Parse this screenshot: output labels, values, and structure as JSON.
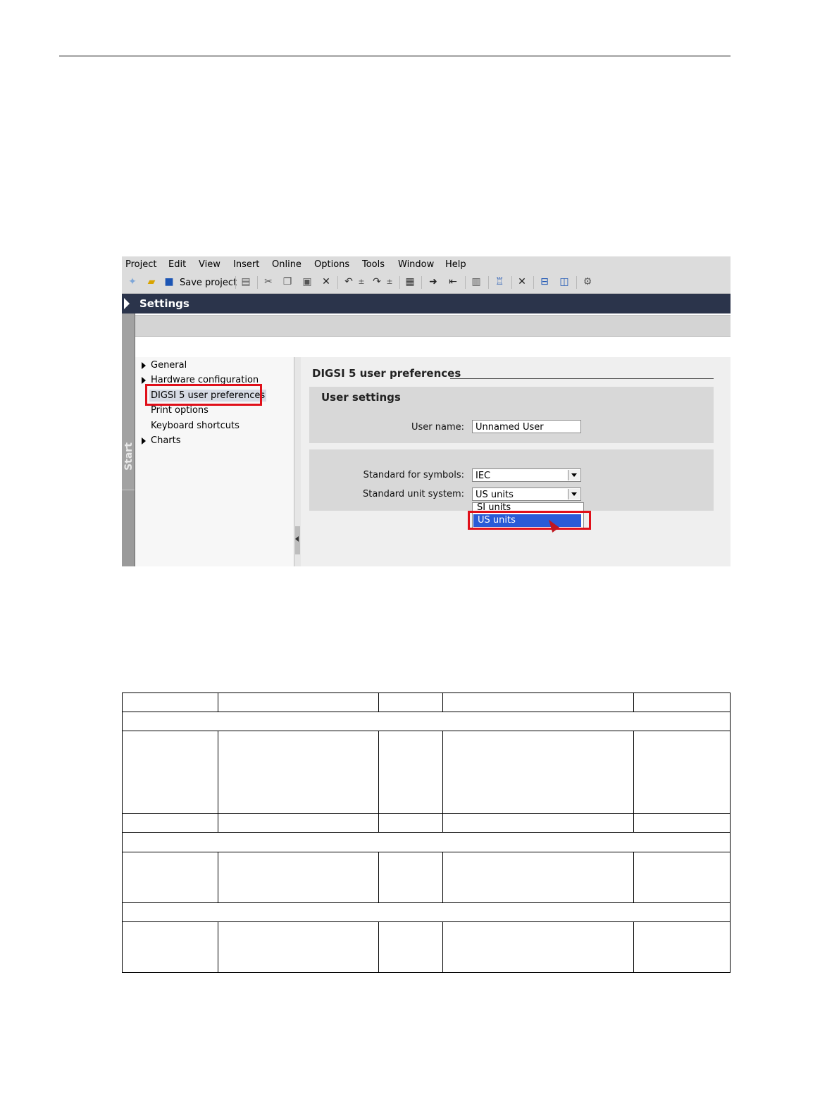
{
  "menu": [
    "Project",
    "Edit",
    "View",
    "Insert",
    "Online",
    "Options",
    "Tools",
    "Window",
    "Help"
  ],
  "toolbar": {
    "save_label": "Save project"
  },
  "window": {
    "title": "Settings",
    "start_tab": "Start"
  },
  "tree": [
    {
      "label": "General",
      "expandable": true
    },
    {
      "label": "Hardware configuration",
      "expandable": true
    },
    {
      "label": "DIGSI 5 user preferences",
      "expandable": false,
      "selected": true
    },
    {
      "label": "Print options",
      "expandable": false
    },
    {
      "label": "Keyboard shortcuts",
      "expandable": false
    },
    {
      "label": "Charts",
      "expandable": true
    }
  ],
  "content": {
    "section_title": "DIGSI 5 user preferences",
    "user_settings_title": "User settings",
    "user_name_label": "User name:",
    "user_name_value": "Unnamed User",
    "symbols_label": "Standard for symbols:",
    "symbols_value": "IEC",
    "unit_label": "Standard unit system:",
    "unit_value": "US units",
    "dropdown_options": [
      "SI units",
      "US units"
    ],
    "dropdown_selected": "US units"
  },
  "colors": {
    "highlight_border": "#e0101a",
    "selection": "#2a5bd7",
    "titlebar": "#2b344b"
  }
}
